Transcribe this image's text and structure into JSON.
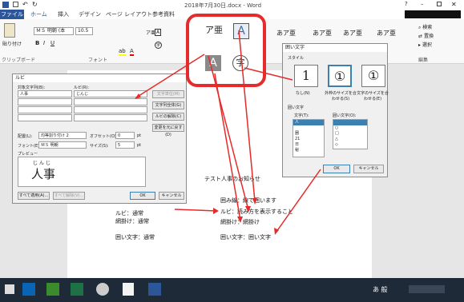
{
  "window": {
    "title": "2018年7月30日.docx - Word"
  },
  "tabs": [
    "ファイル",
    "ホーム",
    "挿入",
    "デザイン",
    "ページ レイアウト",
    "参考資料"
  ],
  "ribbon": {
    "paste": "貼り付け",
    "clipboard": "クリップボード",
    "font_name": "ＭＳ 明朝 (本",
    "font_size": "10.5",
    "font_group": "フォント",
    "styles": [
      "あア亜",
      "あア亜",
      "あア亜",
      "あア亜"
    ],
    "search": "検索",
    "replace": "置換",
    "select": "選択",
    "edit_group": "編集"
  },
  "ruby_dialog": {
    "title": "ルビ",
    "target_label": "対象文字列(B):",
    "ruby_label": "ルビ(R):",
    "target_value": "人事",
    "ruby_value": "じんじ",
    "side_buttons": [
      "文字単位(M)",
      "文字列全体(G)",
      "ルビの解除(C)",
      "変更を元に戻す(D)"
    ],
    "align_label": "配置(L):",
    "align_value": "均等割り付け 2",
    "offset_label": "オフセット(O):",
    "offset_value": "0",
    "font_label": "フォント(E):",
    "font_value": "ＭＳ 明朝",
    "size_label": "サイズ(S):",
    "size_value": "5",
    "pt": "pt",
    "preview_label": "プレビュー",
    "preview_ruby": "じんじ",
    "preview_base": "人事",
    "apply_all": "すべて適用(A)...",
    "remove_all": "すべて解除(V)...",
    "ok": "OK",
    "cancel": "キャンセル"
  },
  "callout": {
    "icons": [
      "ア亜",
      "A",
      "A",
      "字"
    ]
  },
  "enclose_dialog": {
    "title": "囲い文字",
    "style_label": "スタイル",
    "styles": [
      {
        "glyph": "1",
        "label": "なし(N)"
      },
      {
        "glyph": "①",
        "label": "外枠のサイズを合わせる(S)"
      },
      {
        "glyph": "①",
        "label": "文字のサイズを合わせる(E)"
      }
    ],
    "enclose_label": "囲い文字",
    "char_label": "文字(T):",
    "chars": [
      "人",
      "",
      "圏",
      "21",
      "日",
      "秘"
    ],
    "shape_label": "囲い文字(O):",
    "shapes": [
      "",
      "○",
      "□",
      "△",
      "◇"
    ],
    "ok": "OK",
    "cancel": "キャンセル"
  },
  "doc": {
    "heading": "テスト人事のお知らせ",
    "lines": [
      "囲み線：線で囲います",
      "ルビ：読み方を表示すること",
      "網掛け：網掛け",
      "囲い文字：囲い文字"
    ],
    "left_lines": [
      "ルビ：通常",
      "網掛け：通常",
      "囲い文字：通常"
    ]
  },
  "colors": {
    "word_blue": "#2b579a",
    "callout_red": "#e52b2b",
    "taskbar": "#1f2a38"
  },
  "taskbar": {
    "ime": "あ 般"
  }
}
